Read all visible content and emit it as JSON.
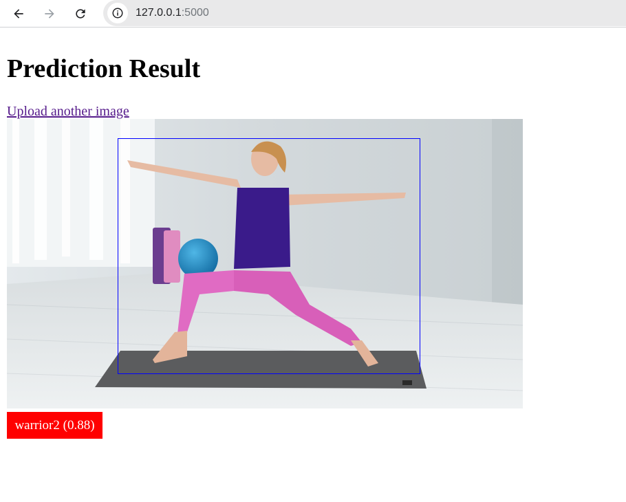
{
  "browser": {
    "url_host": "127.0.0.1",
    "url_port": ":5000",
    "icons": {
      "back": "arrow-left-icon",
      "forward": "arrow-right-icon",
      "reload": "reload-icon",
      "site_info": "info-icon"
    }
  },
  "page": {
    "title": "Prediction Result",
    "upload_link": "Upload another image"
  },
  "result": {
    "label": "warrior2 (0.88)",
    "label_background": "#ff0000",
    "bbox_color": "#0000ff"
  }
}
